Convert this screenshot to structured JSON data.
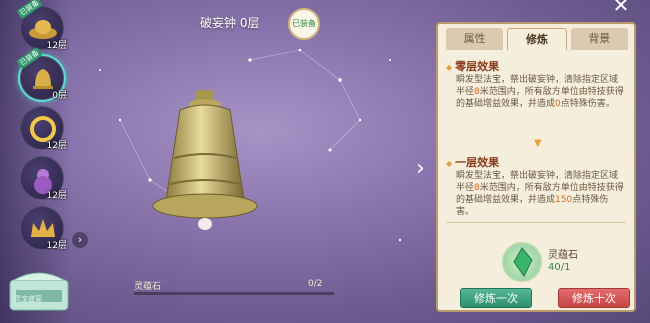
{
  "header": {
    "title": "破妄钟  0层",
    "equipped_badge": "已装备"
  },
  "artifacts": [
    {
      "name": "artifact-hat",
      "level": "12层",
      "tag": "已装备"
    },
    {
      "name": "artifact-bell",
      "level": "0层",
      "tag": "已装备"
    },
    {
      "name": "artifact-ring",
      "level": "12层",
      "tag": ""
    },
    {
      "name": "artifact-gourd",
      "level": "12层",
      "tag": ""
    },
    {
      "name": "artifact-crown",
      "level": "12层",
      "tag": ""
    }
  ],
  "treasure": {
    "label": "灵宝盛宴"
  },
  "progress": {
    "label": "灵蕴石",
    "value": "0/2",
    "fraction": 0
  },
  "panel": {
    "tabs": [
      "属性",
      "修炼",
      "背景"
    ],
    "active_tab": "修炼",
    "section0": {
      "title": "零层效果",
      "text_a": "瞬发型法宝，祭出破妄钟，清除指定区域半径",
      "radius": "8",
      "text_b": "米范围内，所有敌方单位由特技获得的基础增益效果，并造成",
      "dmg": "0",
      "text_c": "点特殊伤害。"
    },
    "section1": {
      "title": "一层效果",
      "text_a": "瞬发型法宝，祭出破妄钟，清除指定区域半径",
      "radius": "8",
      "text_b": "米范围内，所有敌方单位由特技获得的基础增益效果，并造成",
      "dmg": "150",
      "text_c": "点特殊伤害。"
    },
    "item": {
      "name": "灵蕴石",
      "count": "40/1"
    },
    "buttons": {
      "once": "修炼一次",
      "ten": "修炼十次"
    }
  },
  "icons": {
    "close": "close-icon",
    "next": "chevron-right-icon",
    "more": "chevron-right-small-icon"
  },
  "colors": {
    "panel_bg": "#f6eedd",
    "title": "#8a3a1c",
    "highlight": "#d76a1a",
    "green_button": "#2f8f6c",
    "red_button": "#c64545"
  }
}
